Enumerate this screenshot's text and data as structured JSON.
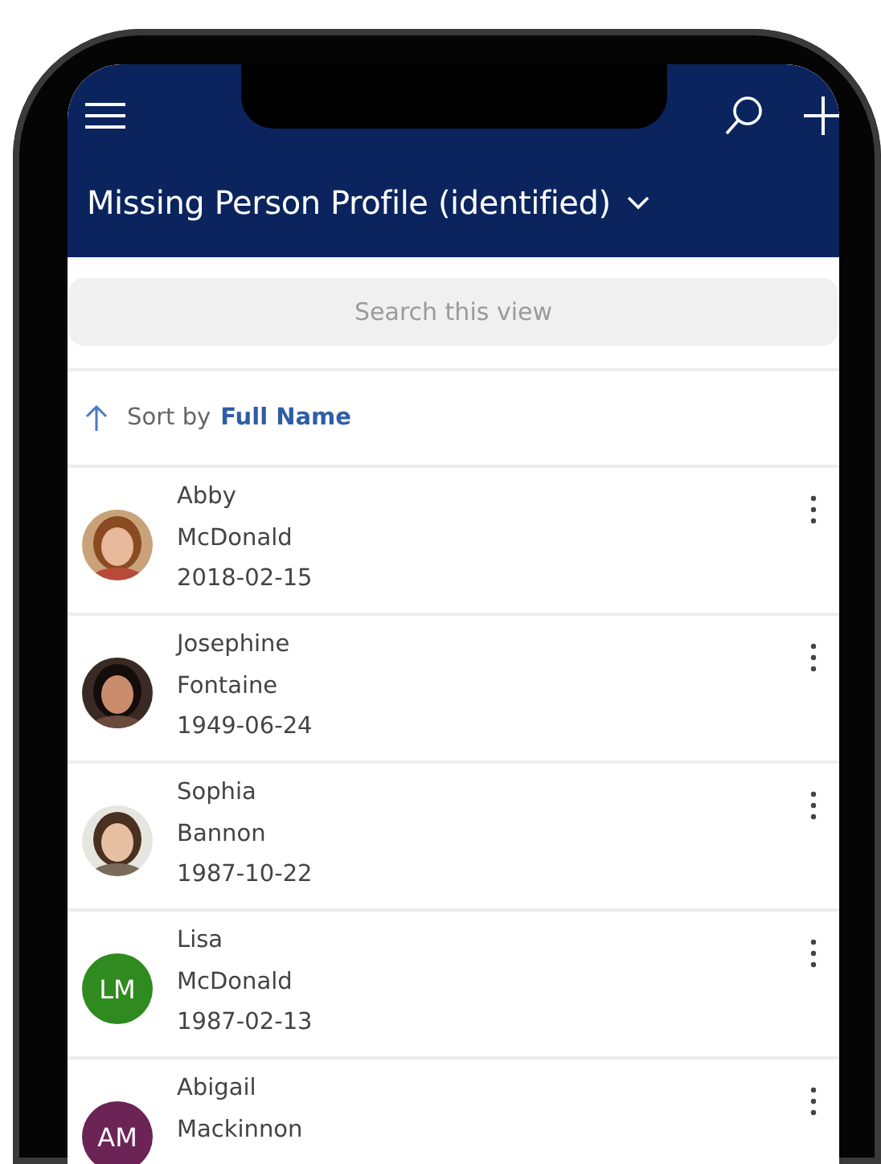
{
  "header": {
    "title": "Missing Person Profile (identified)"
  },
  "search": {
    "placeholder": "Search this view"
  },
  "sort": {
    "label": "Sort by",
    "field": "Full Name"
  },
  "records": [
    {
      "first_name": "Abby",
      "last_name": "McDonald",
      "date": "2018-02-15"
    },
    {
      "first_name": "Josephine",
      "last_name": "Fontaine",
      "date": "1949-06-24"
    },
    {
      "first_name": "Sophia",
      "last_name": "Bannon",
      "date": "1987-10-22"
    },
    {
      "first_name": "Lisa",
      "last_name": "McDonald",
      "date": "1987-02-13",
      "avatar": {
        "kind": "initials",
        "initials": "LM",
        "color": "#2f8a1f"
      }
    },
    {
      "first_name": "Abigail",
      "last_name": "Mackinnon",
      "avatar": {
        "kind": "initials",
        "initials": "AM",
        "color": "#6b2455"
      }
    }
  ]
}
